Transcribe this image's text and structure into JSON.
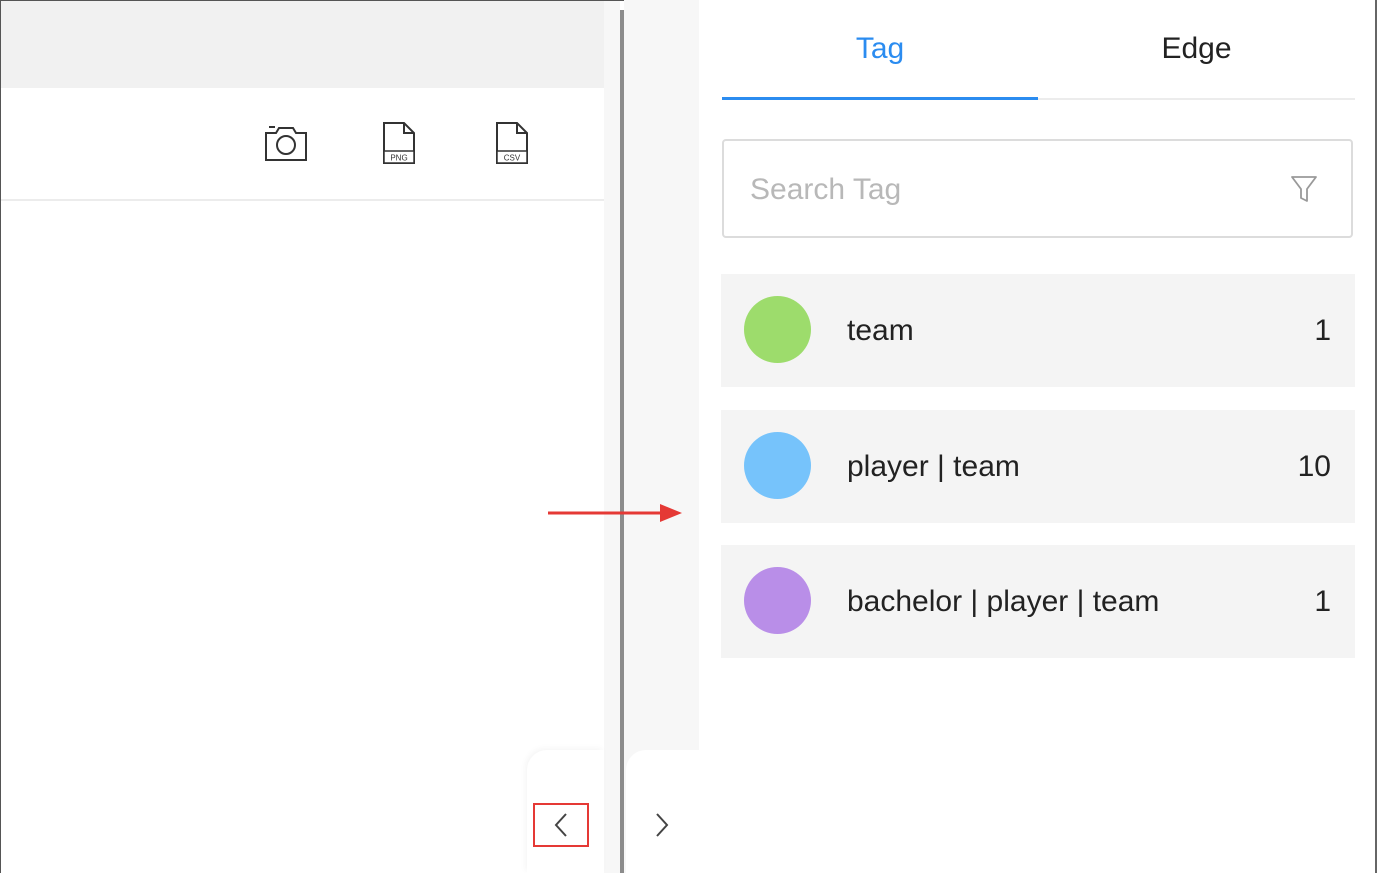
{
  "left_toolbar": {
    "icons": [
      {
        "name": "camera-icon"
      },
      {
        "name": "png-export-icon",
        "label": "PNG"
      },
      {
        "name": "csv-export-icon",
        "label": "CSV"
      }
    ]
  },
  "right_panel": {
    "tabs": [
      {
        "label": "Tag",
        "active": true
      },
      {
        "label": "Edge",
        "active": false
      }
    ],
    "search": {
      "placeholder": "Search Tag",
      "value": ""
    },
    "tags": [
      {
        "label": "team",
        "count": "1",
        "color": "#9ddc6c"
      },
      {
        "label": "player | team",
        "count": "10",
        "color": "#76c3fb"
      },
      {
        "label": "bachelor | player | team",
        "count": "1",
        "color": "#b98ee8"
      }
    ]
  },
  "colors": {
    "accent": "#2b8cf0",
    "annotation_red": "#e53935"
  }
}
